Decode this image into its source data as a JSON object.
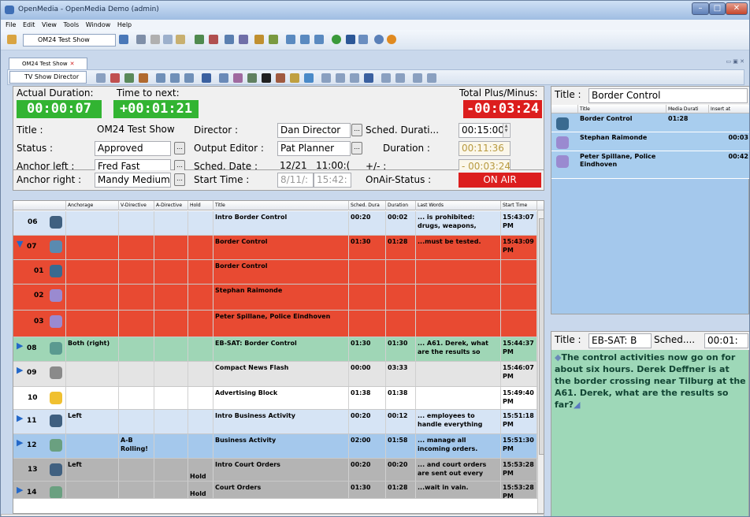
{
  "window": {
    "title": "OpenMedia - OpenMedia Demo (admin)"
  },
  "menu": [
    "File",
    "Edit",
    "View",
    "Tools",
    "Window",
    "Help"
  ],
  "toolbar": {
    "show_combo": "OM24 Test Show"
  },
  "doc_tab": {
    "label": "OM24 Test Show"
  },
  "view_combo": "TV Show Director",
  "summary": {
    "actual_duration_label": "Actual Duration:",
    "actual_duration": "00:00:07",
    "time_to_next_label": "Time to next:",
    "time_to_next": "+00:01:21",
    "total_label": "Total Plus/Minus:",
    "total": "-00:03:24",
    "title_label": "Title :",
    "title": "OM24 Test Show",
    "director_label": "Director :",
    "director": "Dan Director",
    "sched_label": "Sched. Durati...",
    "sched": "00:15:00",
    "status_label": "Status :",
    "status": "Approved",
    "output_editor_label": "Output Editor :",
    "output_editor": "Pat Planner",
    "duration_label": "Duration :",
    "duration": "00:11:36",
    "anchor_left_label": "Anchor left :",
    "anchor_left": "Fred Fast",
    "sched_date_label": "Sched. Date :",
    "sched_date": "12/21",
    "sched_time": "11:00:(",
    "plusminus_label": "+/- :",
    "plusminus": "- 00:03:24",
    "anchor_right_label": "Anchor right :",
    "anchor_right": "Mandy Medium",
    "start_time_label": "Start Time :",
    "start_date": "8/11/:",
    "start_time": "15:42:",
    "onair_label": "OnAir-Status :",
    "onair": "ON AIR"
  },
  "grid": {
    "headers": [
      "Anchorage",
      "V-Directive",
      "A-Directive",
      "Hold",
      "Title",
      "Sched. Dura",
      "Duration",
      "Last Words",
      "Start Time"
    ],
    "rows": [
      {
        "num": "06",
        "anchorage": "",
        "vdir": "",
        "adir": "",
        "hold": "",
        "title": "Intro Border Control",
        "sched": "00:20",
        "dur": "00:02",
        "last": "... is prohibited: drugs, weapons,",
        "start": "15:43:07 PM",
        "bg": "#d6e4f5",
        "arrow": ""
      },
      {
        "num": "07",
        "anchorage": "",
        "vdir": "",
        "adir": "",
        "hold": "",
        "title": "Border Control",
        "sched": "01:30",
        "dur": "01:28",
        "last": "...must be tested.",
        "start": "15:43:09 PM",
        "bg": "#e84a32",
        "arrow": "▼"
      },
      {
        "num": "01",
        "anchorage": "",
        "vdir": "",
        "adir": "",
        "hold": "",
        "title": "Border Control",
        "sched": "",
        "dur": "",
        "last": "",
        "start": "",
        "bg": "#e84a32",
        "arrow": ""
      },
      {
        "num": "02",
        "anchorage": "",
        "vdir": "",
        "adir": "",
        "hold": "",
        "title": "Stephan Raimonde",
        "sched": "",
        "dur": "",
        "last": "",
        "start": "",
        "bg": "#e84a32",
        "arrow": ""
      },
      {
        "num": "03",
        "anchorage": "",
        "vdir": "",
        "adir": "",
        "hold": "",
        "title": "Peter Spillane, Police Eindhoven",
        "sched": "",
        "dur": "",
        "last": "",
        "start": "",
        "bg": "#e84a32",
        "arrow": ""
      },
      {
        "num": "08",
        "anchorage": "Both (right)",
        "vdir": "",
        "adir": "",
        "hold": "",
        "title": "EB-SAT: Border Control",
        "sched": "01:30",
        "dur": "01:30",
        "last": "... A61. Derek, what are the results so",
        "start": "15:44:37 PM",
        "bg": "#9fd6b6",
        "arrow": "▶"
      },
      {
        "num": "09",
        "anchorage": "",
        "vdir": "",
        "adir": "",
        "hold": "",
        "title": "Compact News Flash",
        "sched": "00:00",
        "dur": "03:33",
        "last": "",
        "start": "15:46:07 PM",
        "bg": "#e4e4e4",
        "arrow": "▶"
      },
      {
        "num": "10",
        "anchorage": "",
        "vdir": "",
        "adir": "",
        "hold": "",
        "title": "Advertising Block",
        "sched": "01:38",
        "dur": "01:38",
        "last": "",
        "start": "15:49:40 PM",
        "bg": "#ffffff",
        "arrow": ""
      },
      {
        "num": "11",
        "anchorage": "Left",
        "vdir": "",
        "adir": "",
        "hold": "",
        "title": "Intro Business Activity",
        "sched": "00:20",
        "dur": "00:12",
        "last": "... employees to handle everything",
        "start": "15:51:18 PM",
        "bg": "#d6e4f5",
        "arrow": "▶"
      },
      {
        "num": "12",
        "anchorage": "",
        "vdir": "A-B Rolling!",
        "adir": "",
        "hold": "",
        "title": "Business Activity",
        "sched": "02:00",
        "dur": "01:58",
        "last": "... manage all incoming orders.",
        "start": "15:51:30 PM",
        "bg": "#a4c8ec",
        "arrow": "▶"
      },
      {
        "num": "13",
        "anchorage": "Left",
        "vdir": "",
        "adir": "",
        "hold": "Hold",
        "title": "Intro Court Orders",
        "sched": "00:20",
        "dur": "00:20",
        "last": "... and court orders are sent out every",
        "start": "15:53:28 PM",
        "bg": "#b4b4b4",
        "arrow": ""
      },
      {
        "num": "14",
        "anchorage": "",
        "vdir": "",
        "adir": "",
        "hold": "Hold",
        "title": "Court Orders",
        "sched": "01:30",
        "dur": "01:28",
        "last": "...wait in vain.",
        "start": "15:53:28 PM",
        "bg": "#b4b4b4",
        "arrow": "▶"
      }
    ]
  },
  "right_panel_1": {
    "title_label": "Title :",
    "title": "Border Control",
    "headers": [
      "Title",
      "Media Durati",
      "Insert at"
    ],
    "rows": [
      {
        "title": "Border Control",
        "media": "01:28",
        "insert": ""
      },
      {
        "title": "Stephan Raimonde",
        "media": "",
        "insert": "00:03"
      },
      {
        "title": "Peter Spillane, Police Eindhoven",
        "media": "",
        "insert": "00:42"
      }
    ]
  },
  "right_panel_2": {
    "title_label": "Title :",
    "title": "EB-SAT: B",
    "sched_label": "Sched....",
    "sched": "00:01:",
    "story": "The control activities now go on for about six hours. Derek Deffner is at the border crossing near Tilburg at the A61. Derek, what are the results so far?"
  },
  "colors": {
    "onair": "#dc1e1e",
    "live_row": "#e84a32",
    "timer_green": "#32b432"
  }
}
